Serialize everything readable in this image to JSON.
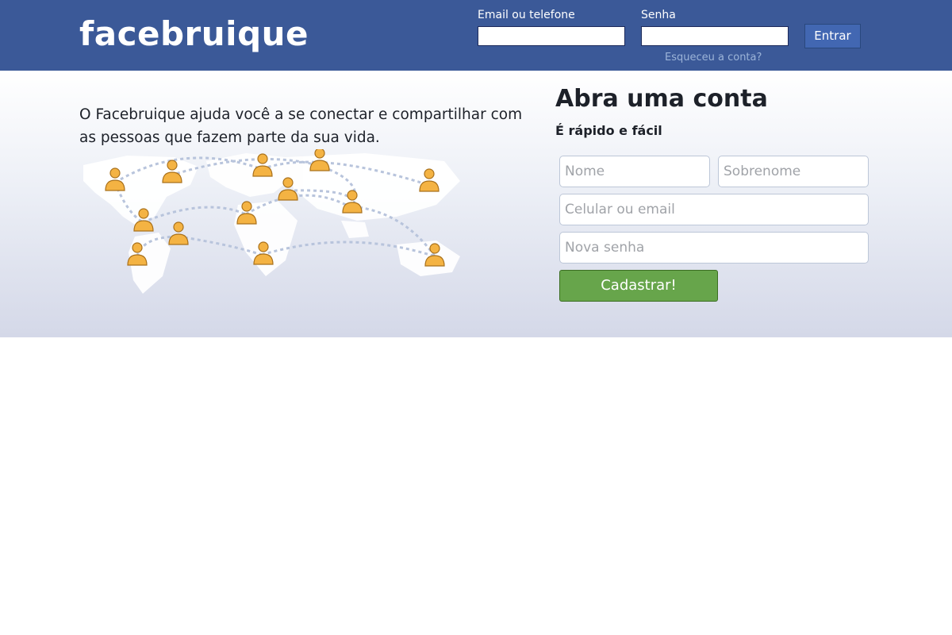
{
  "header": {
    "logo": "facebruique",
    "email_label": "Email ou telefone",
    "password_label": "Senha",
    "login_button": "Entrar",
    "forgot_link": "Esqueceu a conta?",
    "bar_color": "#3b5998"
  },
  "hero": {
    "tagline": "O Facebruique ajuda você a se conectar e compartilhar com as pessoas que fazem parte da sua vida.",
    "illustration": "world-map-people-connections-icon"
  },
  "signup": {
    "title": "Abra uma conta",
    "subtitle": "É rápido e fácil",
    "first_name_placeholder": "Nome",
    "last_name_placeholder": "Sobrenome",
    "contact_placeholder": "Celular ou email",
    "password_placeholder": "Nova senha",
    "submit_button": "Cadastrar!",
    "submit_color": "#67a54b"
  }
}
